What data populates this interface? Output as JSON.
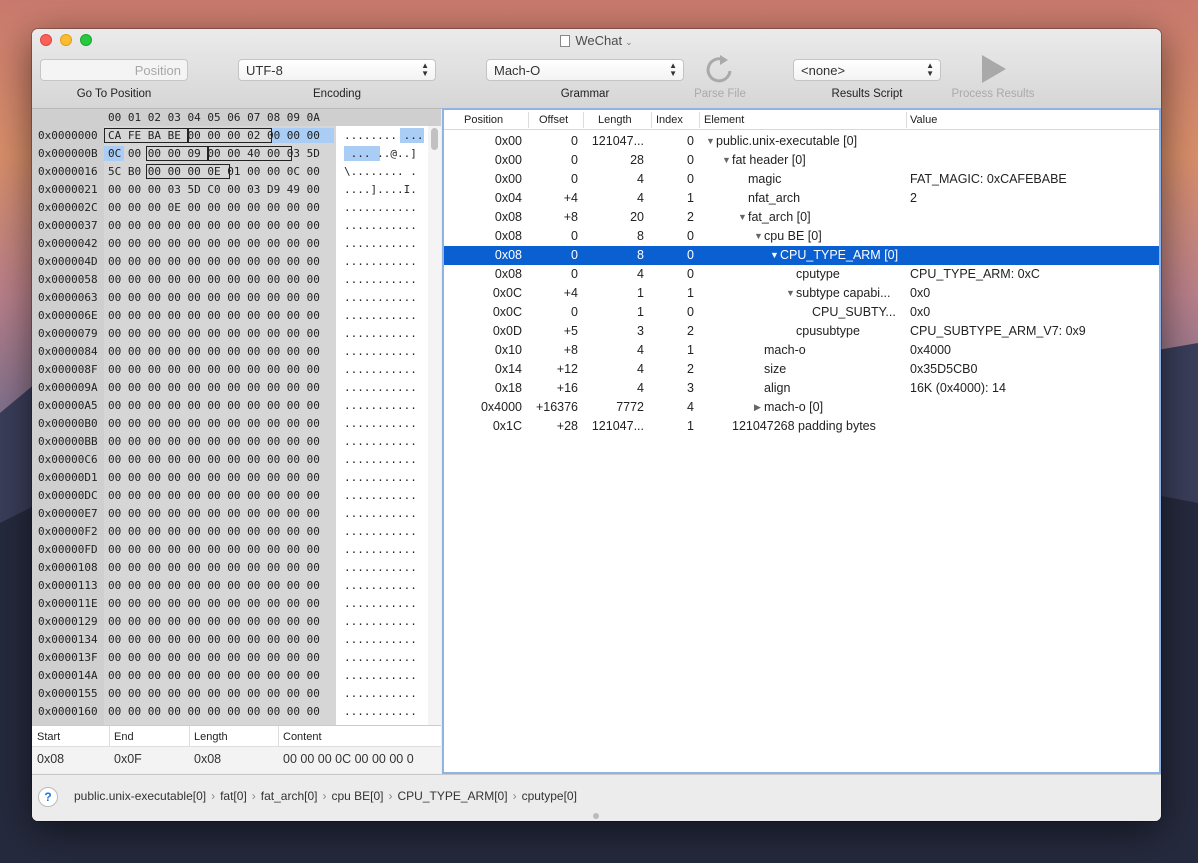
{
  "window": {
    "title": "WeChat"
  },
  "toolbar": {
    "position_placeholder": "Position",
    "go_to_position": "Go To Position",
    "encoding_value": "UTF-8",
    "encoding_label": "Encoding",
    "grammar_value": "Mach-O",
    "grammar_label": "Grammar",
    "parse_file": "Parse File",
    "results_script_value": "<none>",
    "results_script_label": "Results Script",
    "process_results": "Process Results"
  },
  "hex": {
    "column_header": "00 01 02 03 04 05 06 07 08 09 0A",
    "rows": [
      {
        "addr": "0x0000000",
        "hex": "CA FE BA BE 00 00 00 02 00 00 00",
        "ascii": "........ ..."
      },
      {
        "addr": "0x000000B",
        "hex": "0C 00 00 00 09 00 00 40 00 03 5D",
        "ascii": " ... ..@..]"
      },
      {
        "addr": "0x0000016",
        "hex": "5C B0 00 00 00 0E 01 00 00 0C 00",
        "ascii": "\\........ ."
      },
      {
        "addr": "0x0000021",
        "hex": "00 00 00 03 5D C0 00 03 D9 49 00",
        "ascii": "....]....I."
      },
      {
        "addr": "0x000002C",
        "hex": "00 00 00 0E 00 00 00 00 00 00 00",
        "ascii": "..........."
      },
      {
        "addr": "0x0000037",
        "hex": "00 00 00 00 00 00 00 00 00 00 00",
        "ascii": "..........."
      },
      {
        "addr": "0x0000042",
        "hex": "00 00 00 00 00 00 00 00 00 00 00",
        "ascii": "..........."
      },
      {
        "addr": "0x000004D",
        "hex": "00 00 00 00 00 00 00 00 00 00 00",
        "ascii": "..........."
      },
      {
        "addr": "0x0000058",
        "hex": "00 00 00 00 00 00 00 00 00 00 00",
        "ascii": "..........."
      },
      {
        "addr": "0x0000063",
        "hex": "00 00 00 00 00 00 00 00 00 00 00",
        "ascii": "..........."
      },
      {
        "addr": "0x000006E",
        "hex": "00 00 00 00 00 00 00 00 00 00 00",
        "ascii": "..........."
      },
      {
        "addr": "0x0000079",
        "hex": "00 00 00 00 00 00 00 00 00 00 00",
        "ascii": "..........."
      },
      {
        "addr": "0x0000084",
        "hex": "00 00 00 00 00 00 00 00 00 00 00",
        "ascii": "..........."
      },
      {
        "addr": "0x000008F",
        "hex": "00 00 00 00 00 00 00 00 00 00 00",
        "ascii": "..........."
      },
      {
        "addr": "0x000009A",
        "hex": "00 00 00 00 00 00 00 00 00 00 00",
        "ascii": "..........."
      },
      {
        "addr": "0x00000A5",
        "hex": "00 00 00 00 00 00 00 00 00 00 00",
        "ascii": "..........."
      },
      {
        "addr": "0x00000B0",
        "hex": "00 00 00 00 00 00 00 00 00 00 00",
        "ascii": "..........."
      },
      {
        "addr": "0x00000BB",
        "hex": "00 00 00 00 00 00 00 00 00 00 00",
        "ascii": "..........."
      },
      {
        "addr": "0x00000C6",
        "hex": "00 00 00 00 00 00 00 00 00 00 00",
        "ascii": "..........."
      },
      {
        "addr": "0x00000D1",
        "hex": "00 00 00 00 00 00 00 00 00 00 00",
        "ascii": "..........."
      },
      {
        "addr": "0x00000DC",
        "hex": "00 00 00 00 00 00 00 00 00 00 00",
        "ascii": "..........."
      },
      {
        "addr": "0x00000E7",
        "hex": "00 00 00 00 00 00 00 00 00 00 00",
        "ascii": "..........."
      },
      {
        "addr": "0x00000F2",
        "hex": "00 00 00 00 00 00 00 00 00 00 00",
        "ascii": "..........."
      },
      {
        "addr": "0x00000FD",
        "hex": "00 00 00 00 00 00 00 00 00 00 00",
        "ascii": "..........."
      },
      {
        "addr": "0x0000108",
        "hex": "00 00 00 00 00 00 00 00 00 00 00",
        "ascii": "..........."
      },
      {
        "addr": "0x0000113",
        "hex": "00 00 00 00 00 00 00 00 00 00 00",
        "ascii": "..........."
      },
      {
        "addr": "0x000011E",
        "hex": "00 00 00 00 00 00 00 00 00 00 00",
        "ascii": "..........."
      },
      {
        "addr": "0x0000129",
        "hex": "00 00 00 00 00 00 00 00 00 00 00",
        "ascii": "..........."
      },
      {
        "addr": "0x0000134",
        "hex": "00 00 00 00 00 00 00 00 00 00 00",
        "ascii": "..........."
      },
      {
        "addr": "0x000013F",
        "hex": "00 00 00 00 00 00 00 00 00 00 00",
        "ascii": "..........."
      },
      {
        "addr": "0x000014A",
        "hex": "00 00 00 00 00 00 00 00 00 00 00",
        "ascii": "..........."
      },
      {
        "addr": "0x0000155",
        "hex": "00 00 00 00 00 00 00 00 00 00 00",
        "ascii": "..........."
      },
      {
        "addr": "0x0000160",
        "hex": "00 00 00 00 00 00 00 00 00 00 00",
        "ascii": "..........."
      }
    ]
  },
  "selection": {
    "headers": {
      "start": "Start",
      "end": "End",
      "length": "Length",
      "content": "Content"
    },
    "values": {
      "start": "0x08",
      "end": "0x0F",
      "length": "0x08",
      "content": "00 00 00 0C 00 00 00 0"
    }
  },
  "results": {
    "headers": {
      "position": "Position",
      "offset": "Offset",
      "length": "Length",
      "index": "Index",
      "element": "Element",
      "value": "Value"
    },
    "rows": [
      {
        "position": "0x00",
        "offset": "0",
        "length": "121047...",
        "index": "0",
        "element": "public.unix-executable [0]",
        "value": "",
        "triangle": "down"
      },
      {
        "position": "0x00",
        "offset": "0",
        "length": "28",
        "index": "0",
        "element": "fat header [0]",
        "value": "",
        "triangle": "down"
      },
      {
        "position": "0x00",
        "offset": "0",
        "length": "4",
        "index": "0",
        "element": "magic",
        "value": "FAT_MAGIC: 0xCAFEBABE",
        "triangle": ""
      },
      {
        "position": "0x04",
        "offset": "+4",
        "length": "4",
        "index": "1",
        "element": "nfat_arch",
        "value": "2",
        "triangle": ""
      },
      {
        "position": "0x08",
        "offset": "+8",
        "length": "20",
        "index": "2",
        "element": "fat_arch [0]",
        "value": "",
        "triangle": "down"
      },
      {
        "position": "0x08",
        "offset": "0",
        "length": "8",
        "index": "0",
        "element": "cpu BE [0]",
        "value": "",
        "triangle": "down"
      },
      {
        "position": "0x08",
        "offset": "0",
        "length": "8",
        "index": "0",
        "element": "CPU_TYPE_ARM [0]",
        "value": "",
        "triangle": "down"
      },
      {
        "position": "0x08",
        "offset": "0",
        "length": "4",
        "index": "0",
        "element": "cputype",
        "value": "CPU_TYPE_ARM: 0xC",
        "triangle": ""
      },
      {
        "position": "0x0C",
        "offset": "+4",
        "length": "1",
        "index": "1",
        "element": "subtype capabi...",
        "value": "0x0",
        "triangle": "down"
      },
      {
        "position": "0x0C",
        "offset": "0",
        "length": "1",
        "index": "0",
        "element": "CPU_SUBTY...",
        "value": "0x0",
        "triangle": ""
      },
      {
        "position": "0x0D",
        "offset": "+5",
        "length": "3",
        "index": "2",
        "element": "cpusubtype",
        "value": "CPU_SUBTYPE_ARM_V7: 0x9",
        "triangle": ""
      },
      {
        "position": "0x10",
        "offset": "+8",
        "length": "4",
        "index": "1",
        "element": "mach-o",
        "value": "0x4000",
        "triangle": ""
      },
      {
        "position": "0x14",
        "offset": "+12",
        "length": "4",
        "index": "2",
        "element": "size",
        "value": "0x35D5CB0",
        "triangle": ""
      },
      {
        "position": "0x18",
        "offset": "+16",
        "length": "4",
        "index": "3",
        "element": "align",
        "value": "16K (0x4000): 14",
        "triangle": ""
      },
      {
        "position": "0x4000",
        "offset": "+16376",
        "length": "7772",
        "index": "4",
        "element": "mach-o [0]",
        "value": "",
        "triangle": "right"
      },
      {
        "position": "0x1C",
        "offset": "+28",
        "length": "121047...",
        "index": "1",
        "element": "121047268 padding bytes",
        "value": "",
        "triangle": ""
      }
    ]
  },
  "footer": {
    "help": "?",
    "breadcrumbs": [
      "public.unix-executable[0]",
      "fat[0]",
      "fat_arch[0]",
      "cpu BE[0]",
      "CPU_TYPE_ARM[0]",
      "cputype[0]"
    ]
  }
}
